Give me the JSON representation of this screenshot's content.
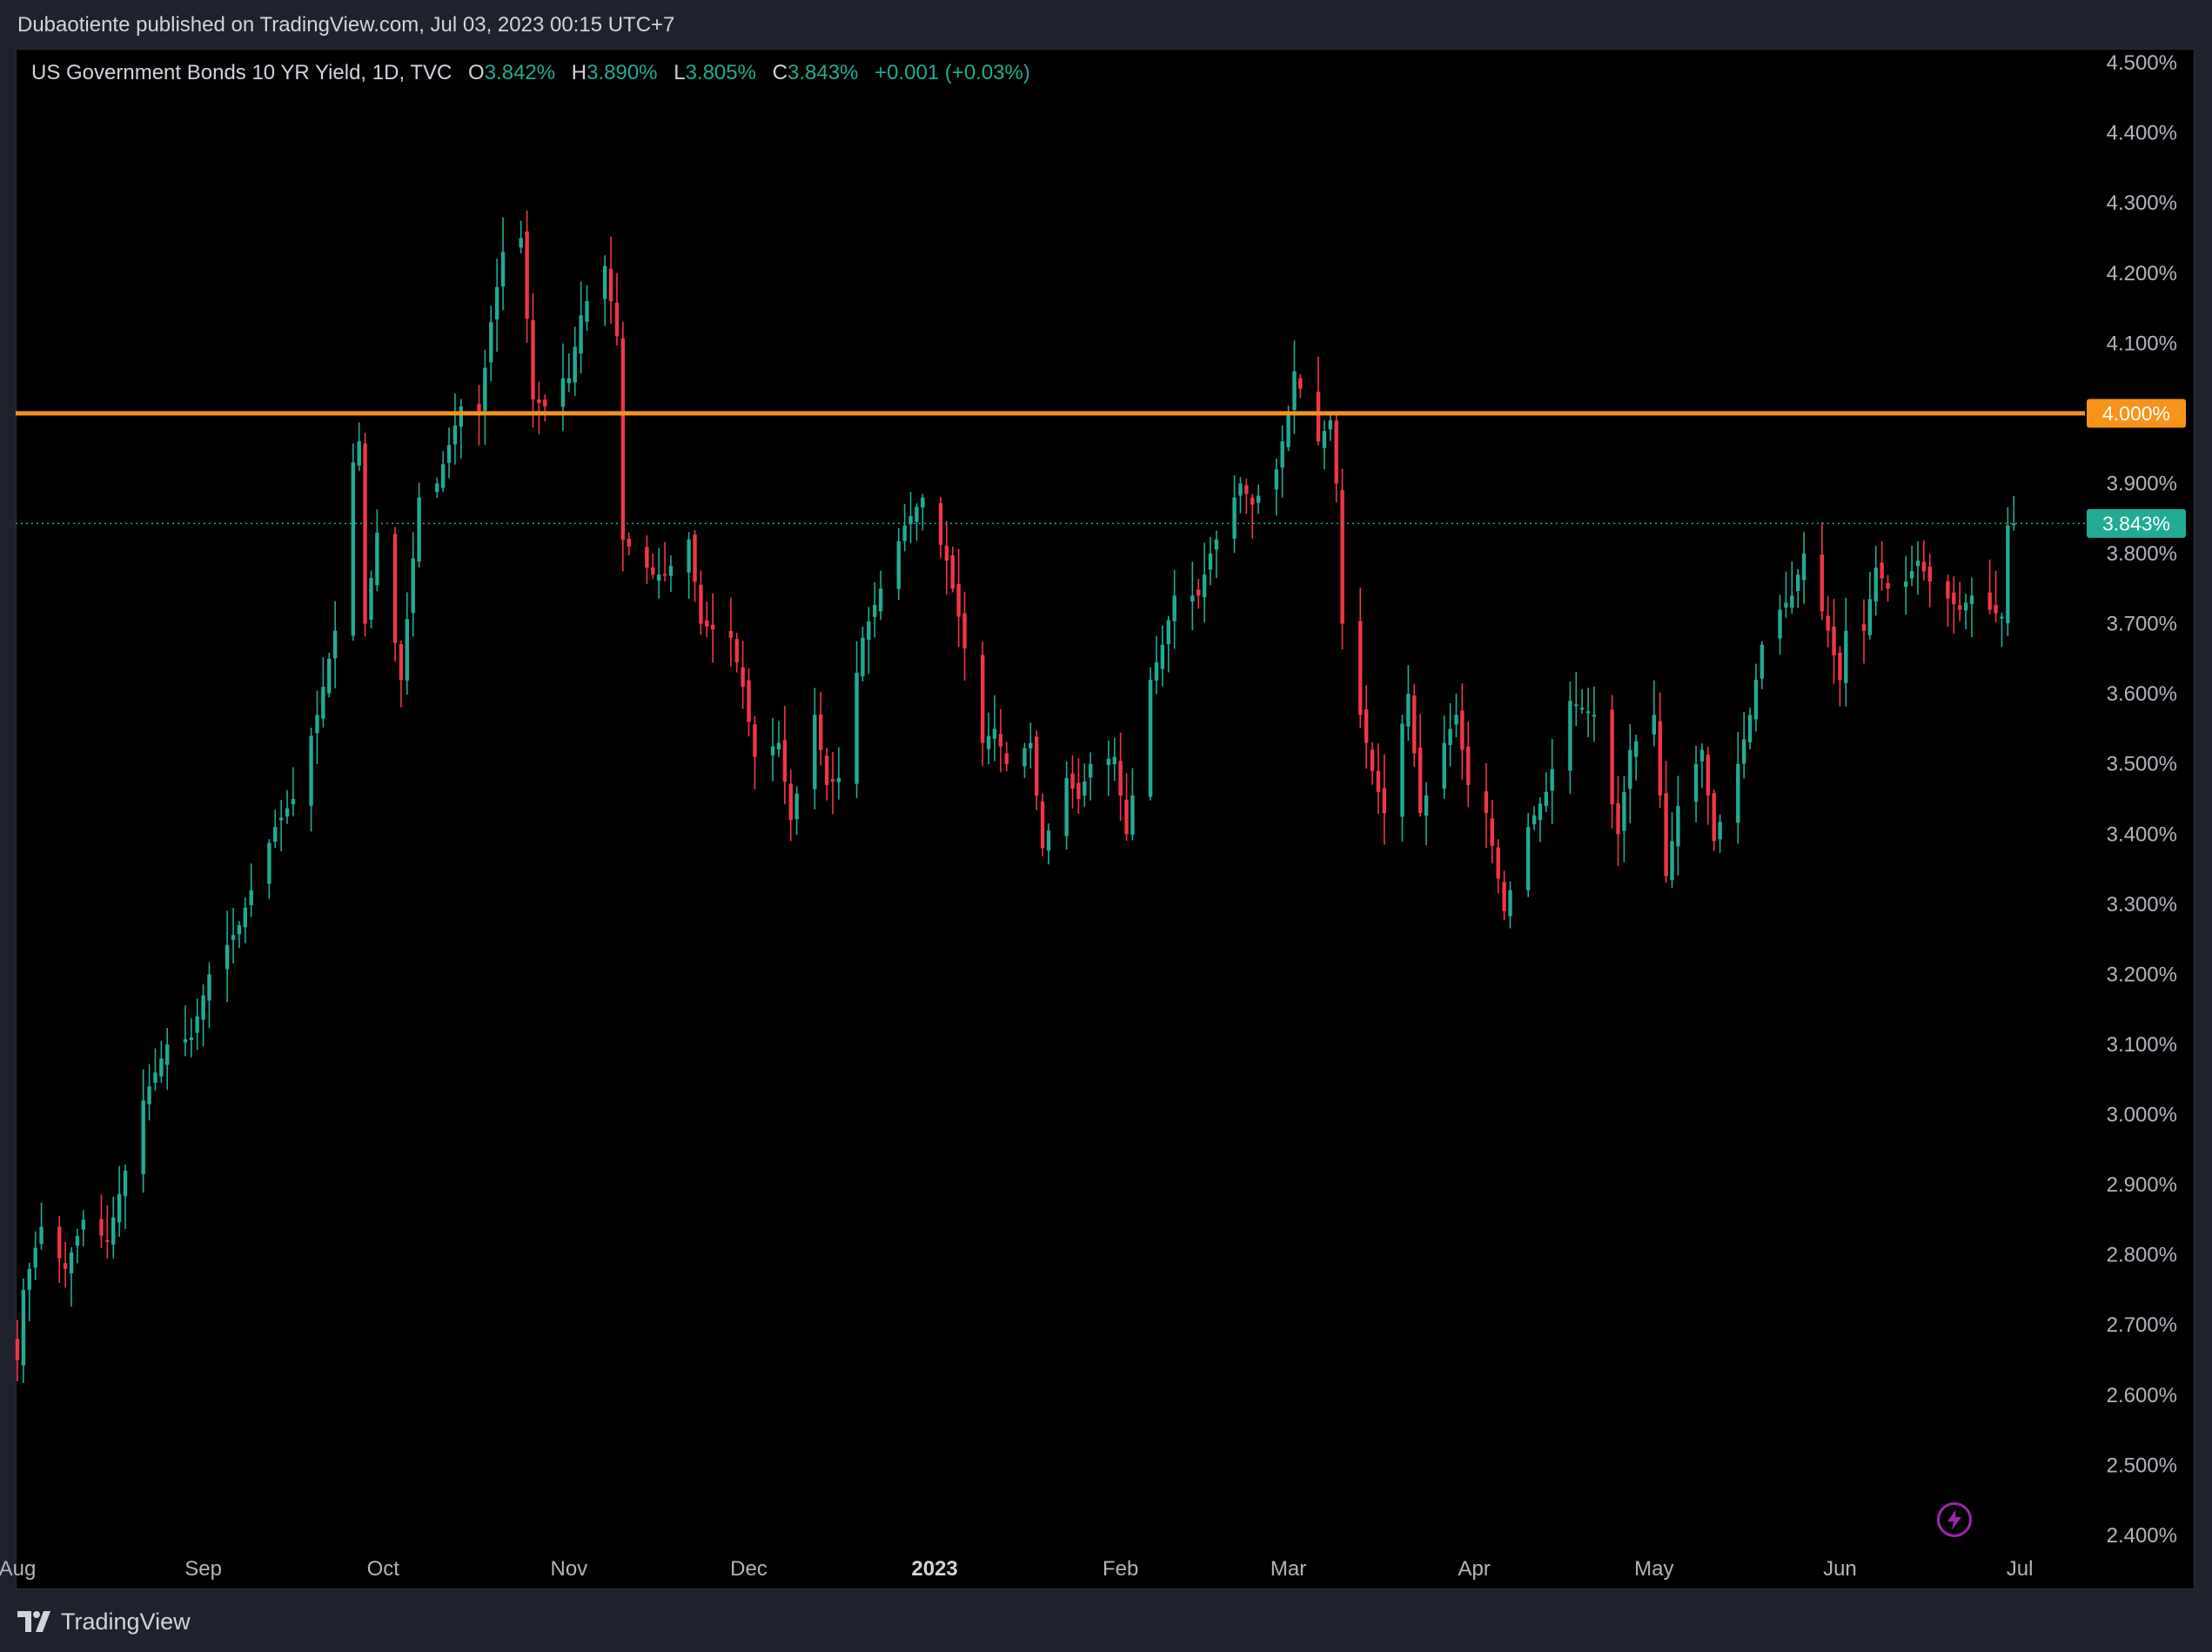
{
  "header": {
    "publisher_line": "Dubaotiente published on TradingView.com, Jul 03, 2023 00:15 UTC+7"
  },
  "legend": {
    "symbol": "US Government Bonds 10 YR Yield, 1D, TVC",
    "open_label": "O",
    "open": "3.842%",
    "high_label": "H",
    "high": "3.890%",
    "low_label": "L",
    "low": "3.805%",
    "close_label": "C",
    "close": "3.843%",
    "change": "+0.001 (+0.03%)"
  },
  "footer": {
    "brand": "TradingView"
  },
  "colors": {
    "up": "#22ab94",
    "down": "#f23645",
    "level_line": "#f7931a",
    "background": "#000000",
    "axis_text": "#b2b5be"
  },
  "icons": {
    "flash": "lightning-bolt-icon",
    "logo": "tradingview-logo-icon"
  },
  "chart_data": {
    "type": "candlestick",
    "y_axis": {
      "ticks": [
        "4.500%",
        "4.400%",
        "4.300%",
        "4.200%",
        "4.100%",
        "4.000%",
        "3.900%",
        "3.800%",
        "3.700%",
        "3.600%",
        "3.500%",
        "3.400%",
        "3.300%",
        "3.200%",
        "3.100%",
        "3.000%",
        "2.900%",
        "2.800%",
        "2.700%",
        "2.600%",
        "2.500%",
        "2.400%"
      ],
      "range": [
        2.38,
        4.52
      ],
      "side": "right"
    },
    "x_axis": {
      "labels": [
        "Aug",
        "Sep",
        "Oct",
        "Nov",
        "Dec",
        "2023",
        "Feb",
        "Mar",
        "Apr",
        "May",
        "Jun",
        "Jul"
      ],
      "bold_label": "2023",
      "range": [
        "2022-08-01",
        "2023-07-11"
      ]
    },
    "horizontal_line": {
      "value": 4.0,
      "label": "4.000%"
    },
    "last_price": {
      "value": 3.843,
      "label": "3.843%"
    },
    "waypoints": [
      [
        "2022-08-01",
        2.65
      ],
      [
        "2022-08-02",
        2.75
      ],
      [
        "2022-08-05",
        2.84
      ],
      [
        "2022-08-09",
        2.78
      ],
      [
        "2022-08-12",
        2.85
      ],
      [
        "2022-08-16",
        2.82
      ],
      [
        "2022-08-22",
        3.02
      ],
      [
        "2022-08-26",
        3.1
      ],
      [
        "2022-08-30",
        3.11
      ],
      [
        "2022-09-02",
        3.2
      ],
      [
        "2022-09-07",
        3.27
      ],
      [
        "2022-09-09",
        3.32
      ],
      [
        "2022-09-13",
        3.41
      ],
      [
        "2022-09-16",
        3.45
      ],
      [
        "2022-09-20",
        3.57
      ],
      [
        "2022-09-23",
        3.69
      ],
      [
        "2022-09-26",
        3.93
      ],
      [
        "2022-09-27",
        3.96
      ],
      [
        "2022-09-28",
        3.7
      ],
      [
        "2022-09-30",
        3.83
      ],
      [
        "2022-10-04",
        3.62
      ],
      [
        "2022-10-07",
        3.88
      ],
      [
        "2022-10-10",
        3.9
      ],
      [
        "2022-10-14",
        4.01
      ],
      [
        "2022-10-17",
        4.0
      ],
      [
        "2022-10-19",
        4.13
      ],
      [
        "2022-10-21",
        4.23
      ],
      [
        "2022-10-24",
        4.25
      ],
      [
        "2022-10-26",
        4.02
      ],
      [
        "2022-10-28",
        4.01
      ],
      [
        "2022-10-31",
        4.05
      ],
      [
        "2022-11-01",
        4.05
      ],
      [
        "2022-11-03",
        4.14
      ],
      [
        "2022-11-04",
        4.16
      ],
      [
        "2022-11-07",
        4.21
      ],
      [
        "2022-11-09",
        4.11
      ],
      [
        "2022-11-10",
        3.82
      ],
      [
        "2022-11-15",
        3.77
      ],
      [
        "2022-11-17",
        3.77
      ],
      [
        "2022-11-21",
        3.82
      ],
      [
        "2022-11-23",
        3.7
      ],
      [
        "2022-11-28",
        3.68
      ],
      [
        "2022-11-30",
        3.61
      ],
      [
        "2022-12-02",
        3.51
      ],
      [
        "2022-12-06",
        3.53
      ],
      [
        "2022-12-08",
        3.42
      ],
      [
        "2022-12-12",
        3.57
      ],
      [
        "2022-12-14",
        3.47
      ],
      [
        "2022-12-16",
        3.48
      ],
      [
        "2022-12-20",
        3.68
      ],
      [
        "2022-12-23",
        3.75
      ],
      [
        "2022-12-27",
        3.84
      ],
      [
        "2022-12-30",
        3.88
      ],
      [
        "2023-01-03",
        3.79
      ],
      [
        "2023-01-05",
        3.71
      ],
      [
        "2023-01-09",
        3.53
      ],
      [
        "2023-01-11",
        3.55
      ],
      [
        "2023-01-13",
        3.5
      ],
      [
        "2023-01-17",
        3.53
      ],
      [
        "2023-01-19",
        3.38
      ],
      [
        "2023-01-23",
        3.48
      ],
      [
        "2023-01-25",
        3.45
      ],
      [
        "2023-01-27",
        3.5
      ],
      [
        "2023-01-31",
        3.51
      ],
      [
        "2023-02-02",
        3.4
      ],
      [
        "2023-02-06",
        3.62
      ],
      [
        "2023-02-08",
        3.67
      ],
      [
        "2023-02-10",
        3.74
      ],
      [
        "2023-02-14",
        3.74
      ],
      [
        "2023-02-16",
        3.8
      ],
      [
        "2023-02-21",
        3.9
      ],
      [
        "2023-02-23",
        3.87
      ],
      [
        "2023-02-27",
        3.92
      ],
      [
        "2023-03-01",
        4.0
      ],
      [
        "2023-03-02",
        4.06
      ],
      [
        "2023-03-06",
        3.96
      ],
      [
        "2023-03-08",
        3.99
      ],
      [
        "2023-03-09",
        3.9
      ],
      [
        "2023-03-10",
        3.7
      ],
      [
        "2023-03-13",
        3.57
      ],
      [
        "2023-03-15",
        3.49
      ],
      [
        "2023-03-17",
        3.43
      ],
      [
        "2023-03-21",
        3.6
      ],
      [
        "2023-03-23",
        3.43
      ],
      [
        "2023-03-27",
        3.53
      ],
      [
        "2023-03-29",
        3.57
      ],
      [
        "2023-03-31",
        3.47
      ],
      [
        "2023-04-03",
        3.43
      ],
      [
        "2023-04-06",
        3.29
      ],
      [
        "2023-04-10",
        3.41
      ],
      [
        "2023-04-13",
        3.46
      ],
      [
        "2023-04-17",
        3.59
      ],
      [
        "2023-04-21",
        3.57
      ],
      [
        "2023-04-25",
        3.4
      ],
      [
        "2023-04-27",
        3.52
      ],
      [
        "2023-05-01",
        3.57
      ],
      [
        "2023-05-03",
        3.34
      ],
      [
        "2023-05-05",
        3.44
      ],
      [
        "2023-05-09",
        3.52
      ],
      [
        "2023-05-11",
        3.39
      ],
      [
        "2023-05-15",
        3.5
      ],
      [
        "2023-05-17",
        3.57
      ],
      [
        "2023-05-19",
        3.67
      ],
      [
        "2023-05-22",
        3.72
      ],
      [
        "2023-05-24",
        3.74
      ],
      [
        "2023-05-26",
        3.8
      ],
      [
        "2023-05-30",
        3.69
      ],
      [
        "2023-06-01",
        3.62
      ],
      [
        "2023-06-02",
        3.69
      ],
      [
        "2023-06-05",
        3.69
      ],
      [
        "2023-06-07",
        3.78
      ],
      [
        "2023-06-09",
        3.75
      ],
      [
        "2023-06-12",
        3.76
      ],
      [
        "2023-06-14",
        3.79
      ],
      [
        "2023-06-16",
        3.76
      ],
      [
        "2023-06-21",
        3.72
      ],
      [
        "2023-06-23",
        3.74
      ],
      [
        "2023-06-26",
        3.72
      ],
      [
        "2023-06-28",
        3.71
      ],
      [
        "2023-06-29",
        3.84
      ],
      [
        "2023-06-30",
        3.843
      ]
    ]
  }
}
